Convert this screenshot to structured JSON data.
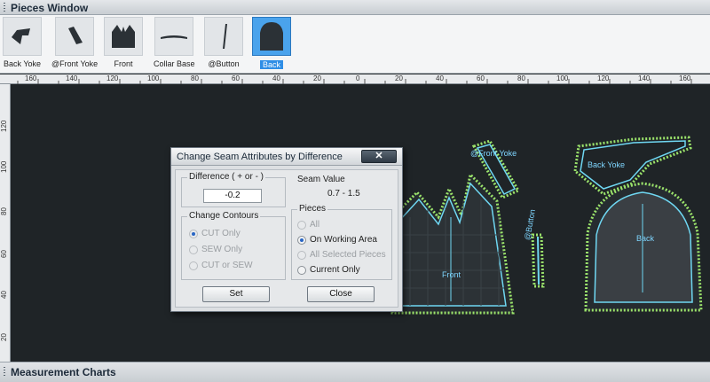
{
  "pieces_window": {
    "title": "Pieces Window",
    "pieces": [
      {
        "label": "Back Yoke",
        "selected": false
      },
      {
        "label": "@Front Yoke",
        "selected": false
      },
      {
        "label": "Front",
        "selected": false
      },
      {
        "label": "Collar Base",
        "selected": false
      },
      {
        "label": "@Button",
        "selected": false
      },
      {
        "label": "Back",
        "selected": true
      }
    ]
  },
  "ruler": {
    "top": [
      "160",
      "140",
      "120",
      "100",
      "80",
      "60",
      "40",
      "20",
      "0",
      "20",
      "40",
      "60",
      "80",
      "100",
      "120",
      "140",
      "160"
    ],
    "left": [
      "120",
      "100",
      "80",
      "60",
      "40",
      "20"
    ]
  },
  "work_area": {
    "piece_labels": {
      "front_yoke": "@Front Yoke",
      "back_yoke": "Back Yoke",
      "front": "Front",
      "button": "@Button",
      "back": "Back"
    }
  },
  "dialog": {
    "title": "Change Seam Attributes by Difference",
    "close_glyph": "✕",
    "difference_group": "Difference ( + or - )",
    "difference_value": "-0.2",
    "seam_value_label": "Seam Value",
    "seam_value": "0.7 - 1.5",
    "contours_group": "Change Contours",
    "contours": [
      {
        "label": "CUT Only",
        "checked": true
      },
      {
        "label": "SEW Only",
        "checked": false
      },
      {
        "label": "CUT or SEW",
        "checked": false
      }
    ],
    "pieces_group": "Pieces",
    "pieces": [
      {
        "label": "All",
        "checked": false,
        "enabled": false
      },
      {
        "label": "On Working Area",
        "checked": true,
        "enabled": true
      },
      {
        "label": "All Selected Pieces",
        "checked": false,
        "enabled": false
      },
      {
        "label": "Current Only",
        "checked": false,
        "enabled": true
      }
    ],
    "set_label": "Set",
    "close_label": "Close"
  },
  "measurement": {
    "title": "Measurement Charts"
  },
  "colors": {
    "workspace": "#1f2427",
    "seam_green": "#9be36b",
    "contour_cyan": "#6fd7f2",
    "selection_blue": "#2f8ee6"
  }
}
